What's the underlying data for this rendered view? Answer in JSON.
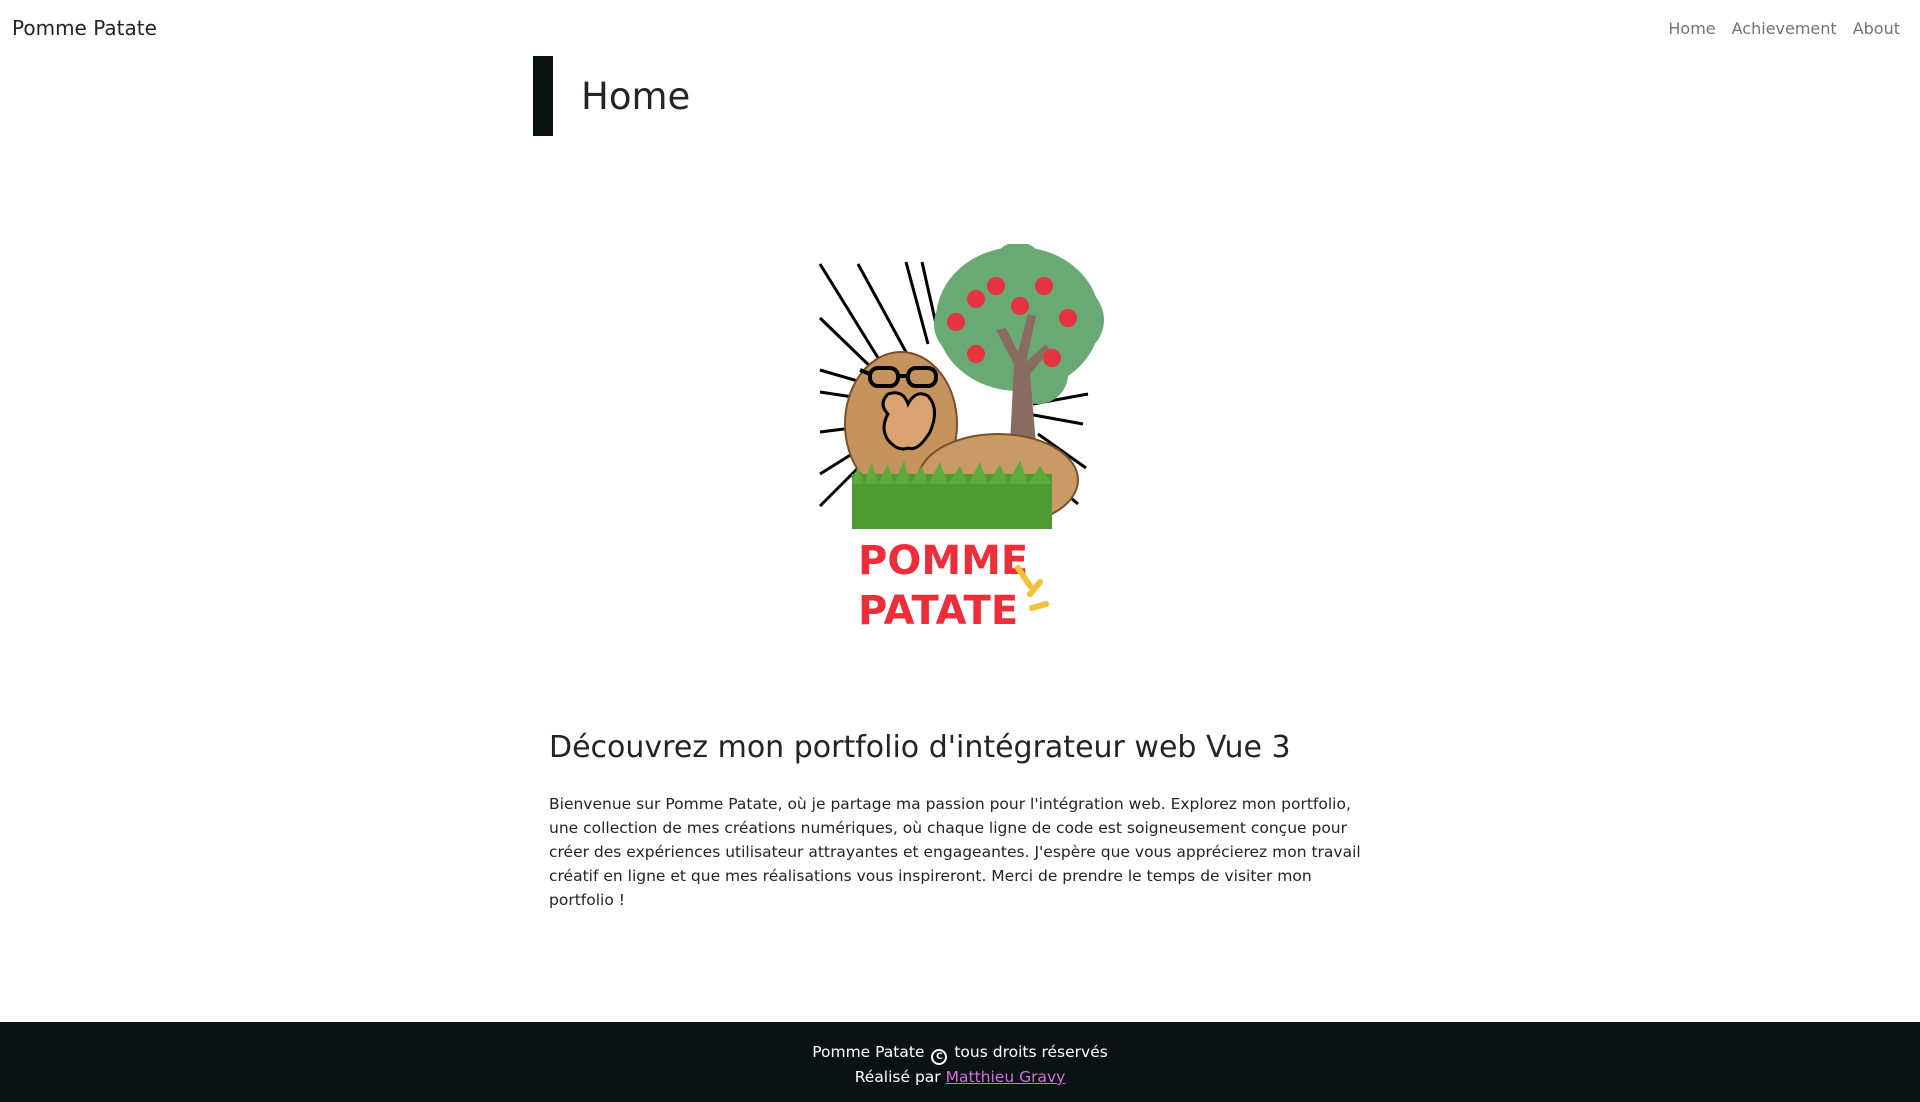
{
  "nav": {
    "brand": "Pomme Patate",
    "links": [
      {
        "label": "Home"
      },
      {
        "label": "Achievement"
      },
      {
        "label": "About"
      }
    ]
  },
  "header": {
    "title": "Home"
  },
  "logo": {
    "text_line1": "POMME",
    "text_line2": "PATATE",
    "brand_color": "#ec2e3b",
    "accent_color": "#f2c23a"
  },
  "main": {
    "heading": "Découvrez mon portfolio d'intégrateur web Vue 3",
    "paragraph": "Bienvenue sur Pomme Patate, où je partage ma passion pour l'intégration web. Explorez mon portfolio, une collection de mes créations numériques, où chaque ligne de code est soigneusement conçue pour créer des expériences utilisateur attrayantes et engageantes. J'espère que vous apprécierez mon travail créatif en ligne et que mes réalisations vous inspireront. Merci de prendre le temps de visiter mon portfolio !"
  },
  "footer": {
    "line1_prefix": "Pomme Patate",
    "copyright_icon": "copyright-icon",
    "line1_suffix": "tous droits réservés",
    "line2_prefix": "Réalisé par",
    "author": "Matthieu Gravy",
    "link_color": "#d46fe0",
    "background": "#0b1214"
  }
}
